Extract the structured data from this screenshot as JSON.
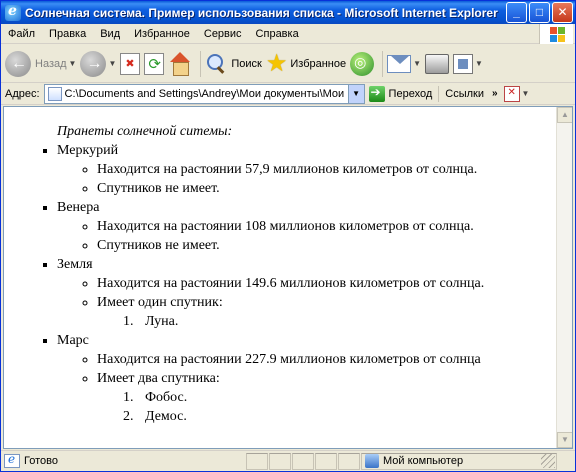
{
  "window": {
    "title": "Солнечная система. Пример использования списка - Microsoft Internet Explorer"
  },
  "menu": [
    "Файл",
    "Правка",
    "Вид",
    "Избранное",
    "Сервис",
    "Справка"
  ],
  "toolbar": {
    "back_label": "Назад",
    "search_label": "Поиск",
    "favorites_label": "Избранное"
  },
  "address": {
    "label": "Адрес:",
    "value": "C:\\Documents and Settings\\Andrey\\Мои документы\\Мои в",
    "go_label": "Переход",
    "links_label": "Ссылки"
  },
  "page": {
    "caption": "Пранеты солнечной ситемы:",
    "planets": [
      {
        "name": "Меркурий",
        "facts": [
          "Находится на растоянии 57,9 миллионов километров от солнца.",
          "Спутников не имеет."
        ],
        "moons": []
      },
      {
        "name": "Венера",
        "facts": [
          "Находится на растоянии 108 миллионов километров от солнца.",
          "Спутников не имеет."
        ],
        "moons": []
      },
      {
        "name": "Земля",
        "facts": [
          "Находится на растоянии 149.6 миллионов километров от солнца.",
          "Имеет один спутник:"
        ],
        "moons": [
          "Луна."
        ]
      },
      {
        "name": "Марс",
        "facts": [
          "Находится на растоянии 227.9 миллионов километров от солнца",
          "Имеет два спутника:"
        ],
        "moons": [
          "Фобос.",
          "Демос."
        ]
      }
    ]
  },
  "status": {
    "text": "Готово",
    "zone": "Мой компьютер"
  }
}
